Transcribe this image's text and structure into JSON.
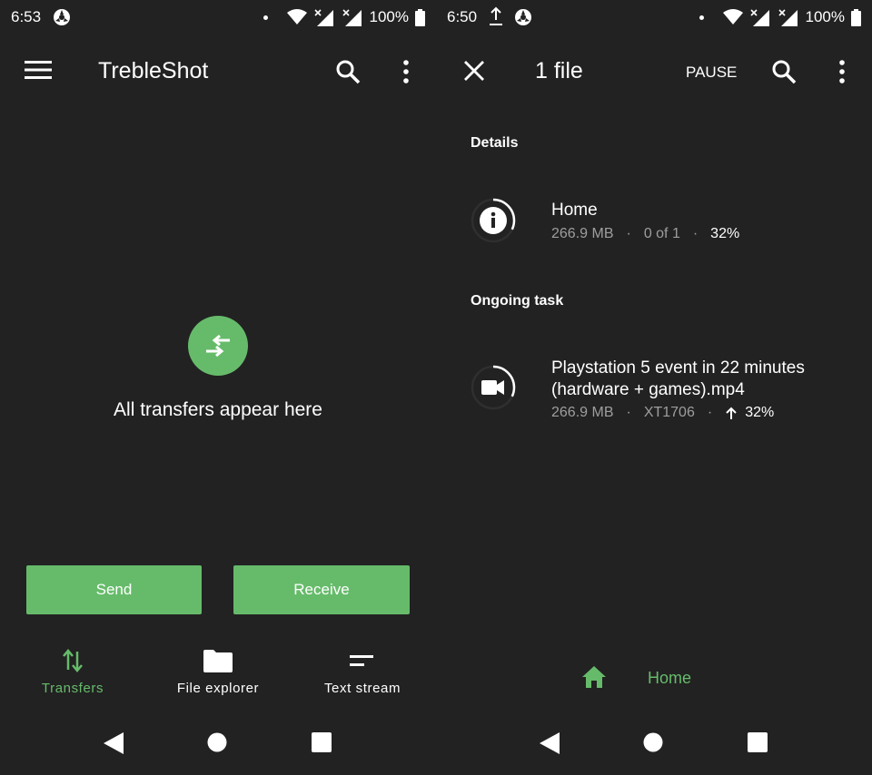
{
  "left": {
    "status": {
      "time": "6:53",
      "battery": "100%"
    },
    "appbar": {
      "title": "TrebleShot"
    },
    "empty": {
      "message": "All transfers appear here"
    },
    "buttons": {
      "send": "Send",
      "receive": "Receive"
    },
    "bottom_nav": [
      {
        "label": "Transfers",
        "icon": "swap-vertical-icon",
        "active": true
      },
      {
        "label": "File explorer",
        "icon": "folder-icon",
        "active": false
      },
      {
        "label": "Text stream",
        "icon": "short-text-icon",
        "active": false
      }
    ]
  },
  "right": {
    "status": {
      "time": "6:50",
      "battery": "100%"
    },
    "appbar": {
      "title": "1 file",
      "pause": "PAUSE"
    },
    "details": {
      "heading": "Details",
      "name": "Home",
      "size": "266.9 MB",
      "count": "0 of 1",
      "percent": "32%",
      "progress": 0.32
    },
    "ongoing": {
      "heading": "Ongoing task",
      "file_line1": "Playstation 5 event in 22 minutes",
      "file_line2": "(hardware + games).mp4",
      "size": "266.9 MB",
      "device": "XT1706",
      "percent": "32%",
      "progress": 0.32
    },
    "bottom": {
      "home_label": "Home"
    }
  },
  "colors": {
    "accent": "#66bb6a",
    "background": "#222222",
    "secondary_text": "#9e9e9e"
  }
}
